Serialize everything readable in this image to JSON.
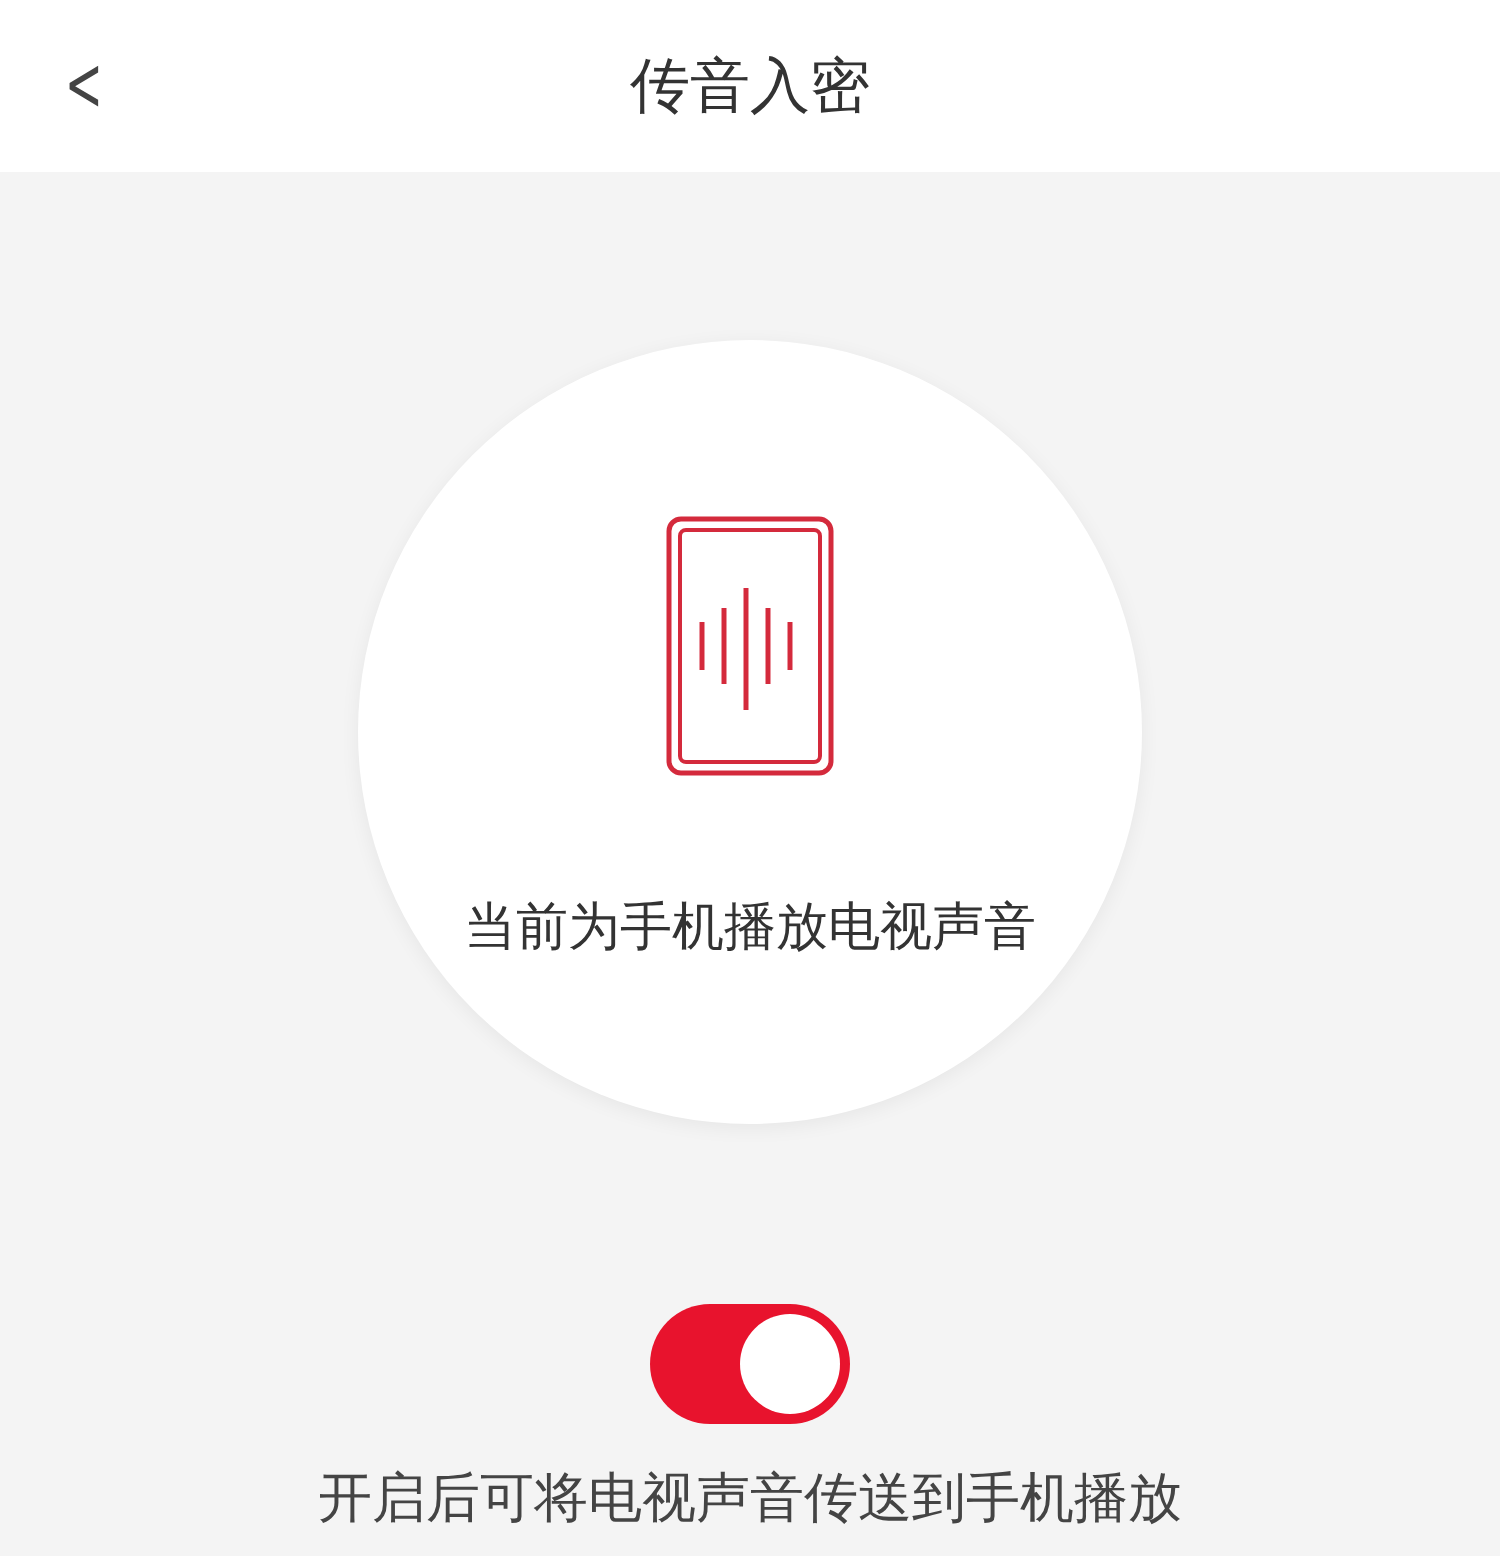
{
  "header": {
    "back": "<",
    "title": "传音入密"
  },
  "status": {
    "text": "当前为手机播放电视声音"
  },
  "toggle": {
    "on": true
  },
  "hint": "开启后可将电视声音传送到手机播放"
}
